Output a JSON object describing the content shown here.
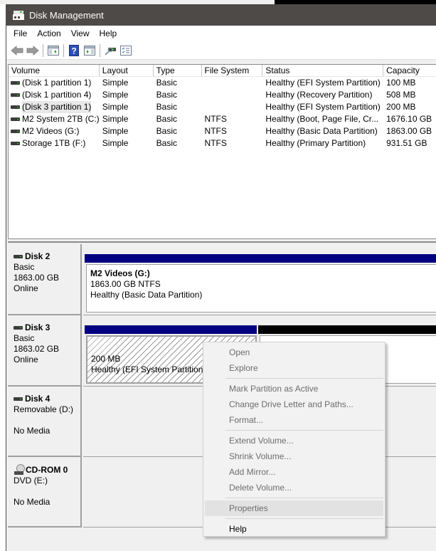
{
  "window": {
    "title": "Disk Management"
  },
  "menubar": {
    "items": [
      "File",
      "Action",
      "View",
      "Help"
    ]
  },
  "toolbar": {
    "buttons": [
      {
        "icon": "back-arrow-icon"
      },
      {
        "icon": "forward-arrow-icon"
      },
      {
        "icon": "show-hide-console-tree-icon"
      },
      {
        "icon": "help-icon"
      },
      {
        "icon": "show-hide-action-pane-icon"
      },
      {
        "icon": "connect-disk-icon"
      },
      {
        "icon": "properties-checklist-icon"
      }
    ]
  },
  "volume_list": {
    "columns": [
      "Volume",
      "Layout",
      "Type",
      "File System",
      "Status",
      "Capacity"
    ],
    "rows": [
      {
        "volume": "(Disk 1 partition 1)",
        "layout": "Simple",
        "type": "Basic",
        "fs": "",
        "status": "Healthy (EFI System Partition)",
        "capacity": "100 MB",
        "selected": false
      },
      {
        "volume": "(Disk 1 partition 4)",
        "layout": "Simple",
        "type": "Basic",
        "fs": "",
        "status": "Healthy (Recovery Partition)",
        "capacity": "508 MB",
        "selected": false
      },
      {
        "volume": "(Disk 3 partition 1)",
        "layout": "Simple",
        "type": "Basic",
        "fs": "",
        "status": "Healthy (EFI System Partition)",
        "capacity": "200 MB",
        "selected": true
      },
      {
        "volume": "M2 System 2TB (C:)",
        "layout": "Simple",
        "type": "Basic",
        "fs": "NTFS",
        "status": "Healthy (Boot, Page File, Cr...",
        "capacity": "1676.10 GB",
        "selected": false
      },
      {
        "volume": "M2 Videos (G:)",
        "layout": "Simple",
        "type": "Basic",
        "fs": "NTFS",
        "status": "Healthy (Basic Data Partition)",
        "capacity": "1863.00 GB",
        "selected": false
      },
      {
        "volume": "Storage 1TB (F:)",
        "layout": "Simple",
        "type": "Basic",
        "fs": "NTFS",
        "status": "Healthy (Primary Partition)",
        "capacity": "931.51 GB",
        "selected": false
      }
    ]
  },
  "disks": [
    {
      "name": "Disk 2",
      "line1": "Basic",
      "line2": "1863.00 GB",
      "line3": "Online",
      "partitions": [
        {
          "title": "M2 Videos  (G:)",
          "size": "1863.00 GB NTFS",
          "status": "Healthy (Basic Data Partition)",
          "bar_color": "#000080"
        }
      ]
    },
    {
      "name": "Disk 3",
      "line1": "Basic",
      "line2": "1863.02 GB",
      "line3": "Online",
      "partitions": [
        {
          "title": "",
          "size": "200 MB",
          "status": "Healthy (EFI System Partition)",
          "bar_color": "#000080",
          "selected": true
        },
        {
          "title": "",
          "size": "",
          "status": "",
          "bar_color": "#000000"
        }
      ]
    },
    {
      "name": "Disk 4",
      "line1": "Removable (D:)",
      "line2": "",
      "line3": "No Media"
    },
    {
      "name": "CD-ROM 0",
      "line1": "DVD (E:)",
      "line2": "",
      "line3": "No Media"
    }
  ],
  "context_menu": {
    "groups": [
      [
        {
          "label": "Open",
          "enabled": false
        },
        {
          "label": "Explore",
          "enabled": false
        }
      ],
      [
        {
          "label": "Mark Partition as Active",
          "enabled": false
        },
        {
          "label": "Change Drive Letter and Paths...",
          "enabled": false
        },
        {
          "label": "Format...",
          "enabled": false
        }
      ],
      [
        {
          "label": "Extend Volume...",
          "enabled": false
        },
        {
          "label": "Shrink Volume...",
          "enabled": false
        },
        {
          "label": "Add Mirror...",
          "enabled": false
        },
        {
          "label": "Delete Volume...",
          "enabled": false
        }
      ],
      [
        {
          "label": "Properties",
          "enabled": false,
          "hover": true
        }
      ],
      [
        {
          "label": "Help",
          "enabled": true
        }
      ]
    ]
  },
  "colors": {
    "titlebar": "#4d4a47",
    "primary_partition_bar": "#000080",
    "unallocated_bar": "#000000"
  }
}
